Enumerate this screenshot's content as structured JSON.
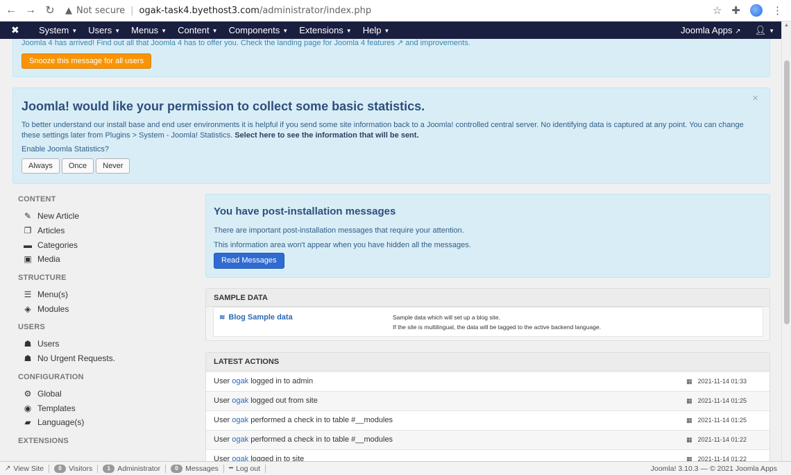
{
  "browser": {
    "security_label": "Not secure",
    "url_host": "ogak-task4.byethost3.com",
    "url_path": "/administrator/index.php"
  },
  "nav": {
    "menus": [
      "System",
      "Users",
      "Menus",
      "Content",
      "Components",
      "Extensions",
      "Help"
    ],
    "apps_label": "Joomla Apps"
  },
  "j4_banner": {
    "text_part1": "Joomla 4 has arrived! Find out all that Joomla 4 has to offer you. Check the landing page for Joomla 4 features",
    "text_part2": "and improvements.",
    "snooze_label": "Snooze this message for all users"
  },
  "stats": {
    "title": "Joomla! would like your permission to collect some basic statistics.",
    "description": "To better understand our install base and end user environments it is helpful if you send some site information back to a Joomla! controlled central server. No identifying data is captured at any point. You can change these settings later from Plugins > System - Joomla! Statistics.",
    "description_link": "Select here to see the information that will be sent.",
    "question": "Enable Joomla Statistics?",
    "close": "×",
    "buttons": [
      "Always",
      "Once",
      "Never"
    ]
  },
  "sidebar": {
    "groups": [
      {
        "title": "CONTENT",
        "items": [
          {
            "label": "New Article",
            "icon": "pencil-icon"
          },
          {
            "label": "Articles",
            "icon": "copy-icon"
          },
          {
            "label": "Categories",
            "icon": "folder-icon"
          },
          {
            "label": "Media",
            "icon": "image-icon"
          }
        ]
      },
      {
        "title": "STRUCTURE",
        "items": [
          {
            "label": "Menu(s)",
            "icon": "list-icon"
          },
          {
            "label": "Modules",
            "icon": "cube-icon"
          }
        ]
      },
      {
        "title": "USERS",
        "items": [
          {
            "label": "Users",
            "icon": "users-icon"
          },
          {
            "label": "No Urgent Requests.",
            "icon": "users-icon"
          }
        ]
      },
      {
        "title": "CONFIGURATION",
        "items": [
          {
            "label": "Global",
            "icon": "cog-icon"
          },
          {
            "label": "Templates",
            "icon": "eye-icon"
          },
          {
            "label": "Language(s)",
            "icon": "comments-icon"
          }
        ]
      },
      {
        "title": "EXTENSIONS",
        "items": []
      }
    ]
  },
  "post_install": {
    "title": "You have post-installation messages",
    "line1": "There are important post-installation messages that require your attention.",
    "line2": "This information area won't appear when you have hidden all the messages.",
    "button": "Read Messages"
  },
  "sample_data": {
    "header": "SAMPLE DATA",
    "name": "Blog Sample data",
    "desc1": "Sample data which will set up a blog site.",
    "desc2": "If the site is multilingual, the data will be tagged to the active backend language."
  },
  "latest_actions": {
    "header": "LATEST ACTIONS",
    "rows": [
      {
        "prefix": "User",
        "user": "ogak",
        "action": "logged in to admin",
        "date": "2021-11-14 01:33"
      },
      {
        "prefix": "User",
        "user": "ogak",
        "action": "logged out from site",
        "date": "2021-11-14 01:25"
      },
      {
        "prefix": "User",
        "user": "ogak",
        "action": "performed a check in to table #__modules",
        "date": "2021-11-14 01:25"
      },
      {
        "prefix": "User",
        "user": "ogak",
        "action": "performed a check in to table #__modules",
        "date": "2021-11-14 01:22"
      },
      {
        "prefix": "User",
        "user": "ogak",
        "action": "logged in to site",
        "date": "2021-11-14 01:22"
      }
    ]
  },
  "status_bar": {
    "view_site": "View Site",
    "visitors_count": "0",
    "visitors_label": "Visitors",
    "admin_count": "1",
    "admin_label": "Administrator",
    "messages_count": "0",
    "messages_label": "Messages",
    "logout": "Log out",
    "copyright": "Joomla! 3.10.3 — © 2021 Joomla Apps"
  }
}
